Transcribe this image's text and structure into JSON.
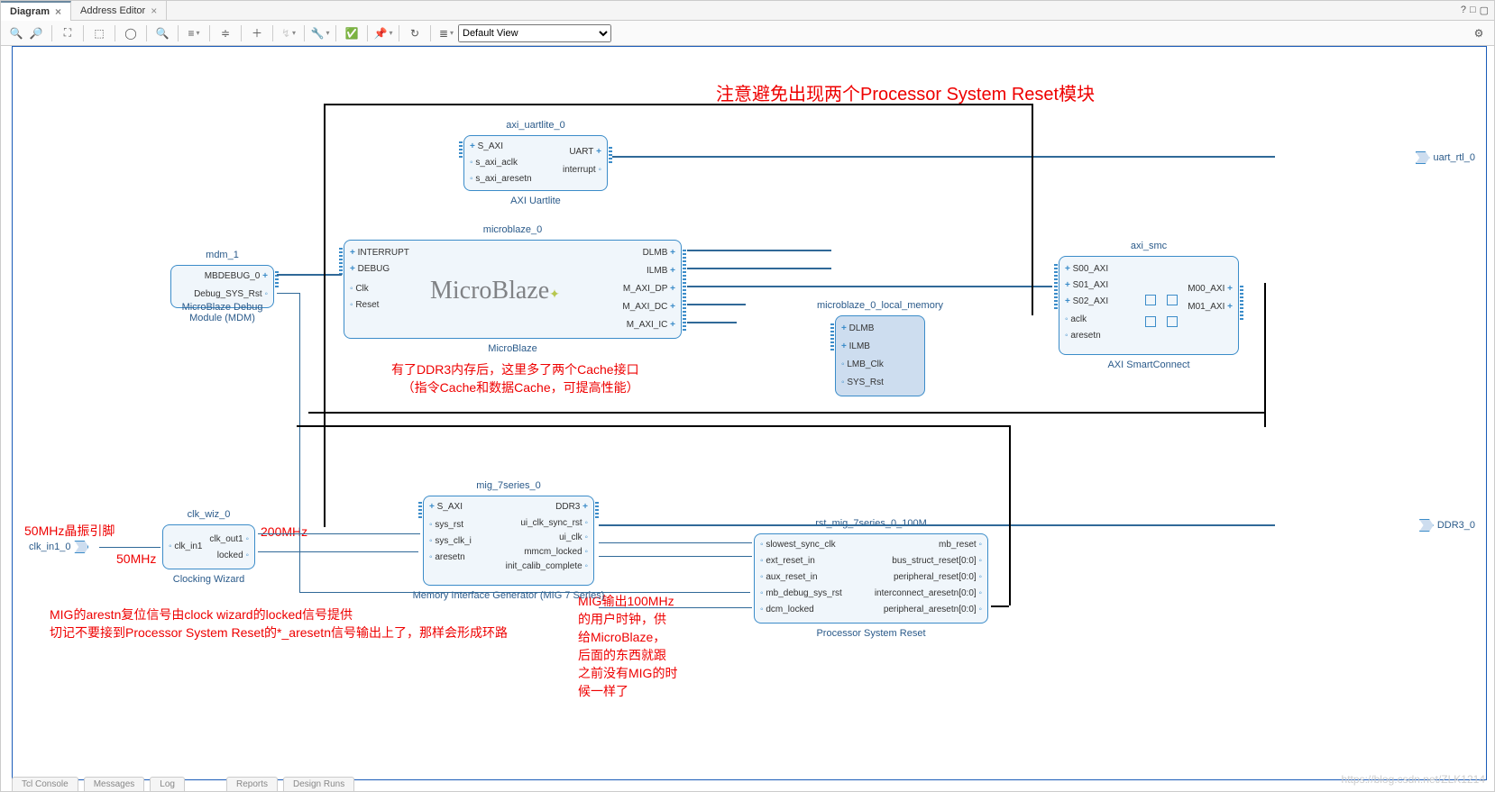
{
  "tabs": {
    "active": "Diagram",
    "inactive": "Address Editor"
  },
  "toolbar": {
    "icons": [
      "zoom-in",
      "zoom-out",
      "zoom-fit",
      "zoom-area",
      "refresh-view",
      "search",
      "align-h",
      "align-v",
      "collapse",
      "add",
      "auto-conn",
      "wrench",
      "validate",
      "pin",
      "regen",
      "dropdown"
    ],
    "view_select": "Default View"
  },
  "ext_ports": {
    "uart": "uart_rtl_0",
    "ddr3": "DDR3_0",
    "clk_in": "clk_in1_0"
  },
  "annotations": {
    "top": "注意避免出现两个Processor System Reset模块",
    "cache": "有了DDR3内存后，这里多了两个Cache接口\n   （指令Cache和数据Cache，可提高性能）",
    "mig_arestn": "MIG的arestn复位信号由clock wizard的locked信号提供\n切记不要接到Processor System Reset的*_aresetn信号输出上了，那样会形成环路",
    "mig_clk": "MIG输出100MHz\n的用户时钟，供\n给MicroBlaze，\n后面的东西就跟\n之前没有MIG的时\n候一样了",
    "clk_pin": "50MHz晶振引脚",
    "clk_50": "50MHz",
    "clk_200": "200MHz"
  },
  "blocks": {
    "mdm": {
      "name": "mdm_1",
      "sub": "MicroBlaze Debug Module (MDM)",
      "outs": [
        "MBDEBUG_0",
        "Debug_SYS_Rst"
      ]
    },
    "uart": {
      "name": "axi_uartlite_0",
      "sub": "AXI Uartlite",
      "ins": [
        "S_AXI",
        "s_axi_aclk",
        "s_axi_aresetn"
      ],
      "outs": [
        "UART",
        "interrupt"
      ]
    },
    "mb": {
      "name": "microblaze_0",
      "sub": "MicroBlaze",
      "logo": "MicroBlaze",
      "ins": [
        "INTERRUPT",
        "DEBUG",
        "Clk",
        "Reset"
      ],
      "outs": [
        "DLMB",
        "ILMB",
        "M_AXI_DP",
        "M_AXI_DC",
        "M_AXI_IC"
      ]
    },
    "lmem": {
      "name": "microblaze_0_local_memory",
      "ins": [
        "DLMB",
        "ILMB",
        "LMB_Clk",
        "SYS_Rst"
      ]
    },
    "smc": {
      "name": "axi_smc",
      "sub": "AXI SmartConnect",
      "ins": [
        "S00_AXI",
        "S01_AXI",
        "S02_AXI",
        "aclk",
        "aresetn"
      ],
      "outs": [
        "M00_AXI",
        "M01_AXI"
      ]
    },
    "clkwiz": {
      "name": "clk_wiz_0",
      "sub": "Clocking Wizard",
      "ins": [
        "clk_in1"
      ],
      "outs": [
        "clk_out1",
        "locked"
      ]
    },
    "mig": {
      "name": "mig_7series_0",
      "sub": "Memory Interface Generator (MIG 7 Series)",
      "ins": [
        "S_AXI",
        "sys_rst",
        "sys_clk_i",
        "aresetn"
      ],
      "outs": [
        "DDR3",
        "ui_clk_sync_rst",
        "ui_clk",
        "mmcm_locked",
        "init_calib_complete"
      ]
    },
    "psr": {
      "name": "rst_mig_7series_0_100M",
      "sub": "Processor System Reset",
      "ins": [
        "slowest_sync_clk",
        "ext_reset_in",
        "aux_reset_in",
        "mb_debug_sys_rst",
        "dcm_locked"
      ],
      "outs": [
        "mb_reset",
        "bus_struct_reset[0:0]",
        "peripheral_reset[0:0]",
        "interconnect_aresetn[0:0]",
        "peripheral_aresetn[0:0]"
      ]
    }
  },
  "bottom_tabs": [
    "Tcl Console",
    "Messages",
    "Log",
    "Reports",
    "Design Runs"
  ],
  "watermark": "https://blog.csdn.net/ZLK1214"
}
